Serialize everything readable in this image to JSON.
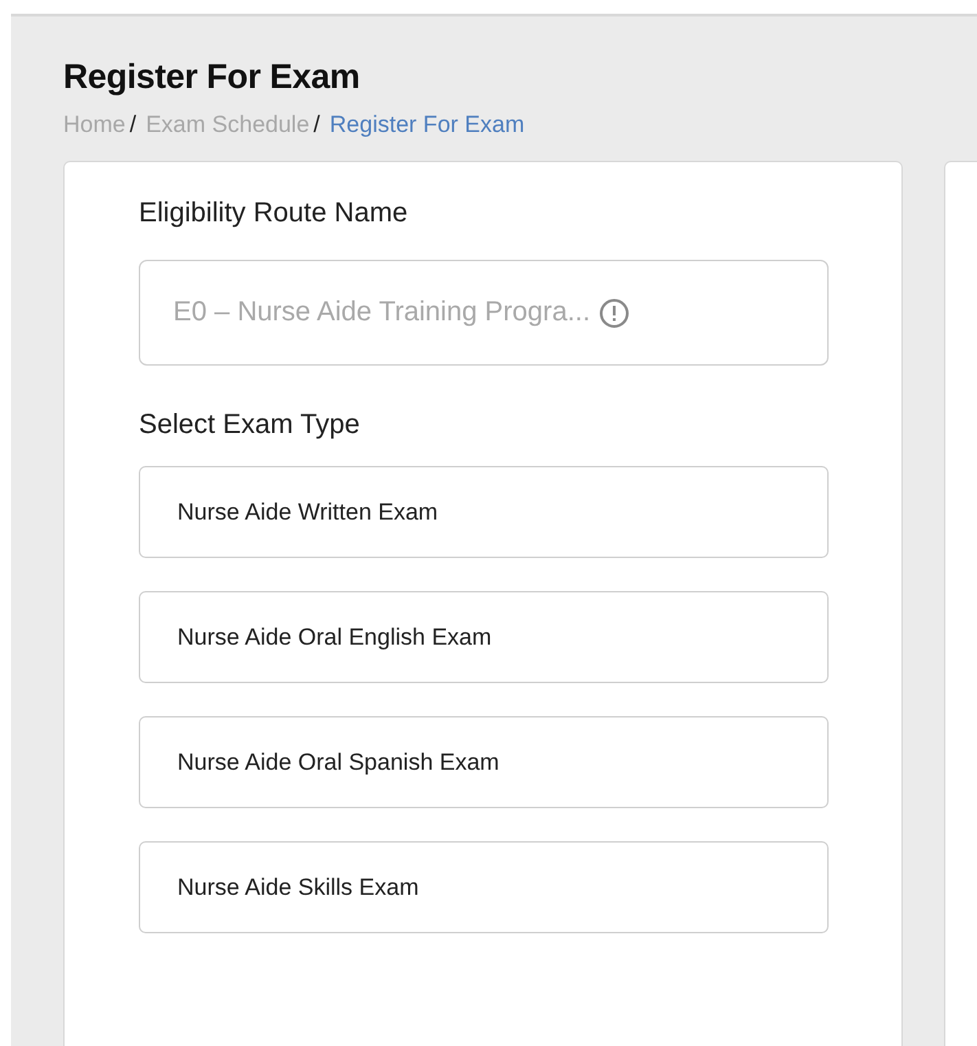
{
  "page_title": "Register For Exam",
  "breadcrumb": [
    {
      "label": "Home",
      "current": false,
      "separator": "/"
    },
    {
      "label": "Exam Schedule",
      "current": false,
      "separator": "/"
    },
    {
      "label": "Register For Exam",
      "current": true
    }
  ],
  "eligibility_route": {
    "label": "Eligibility Route Name",
    "value": "E0 – Nurse Aide Training Progra...",
    "disabled": true
  },
  "exam_type": {
    "label": "Select Exam Type",
    "options": [
      "Nurse Aide Written Exam",
      "Nurse Aide Oral English Exam",
      "Nurse Aide Oral Spanish Exam",
      "Nurse Aide Skills Exam"
    ]
  }
}
